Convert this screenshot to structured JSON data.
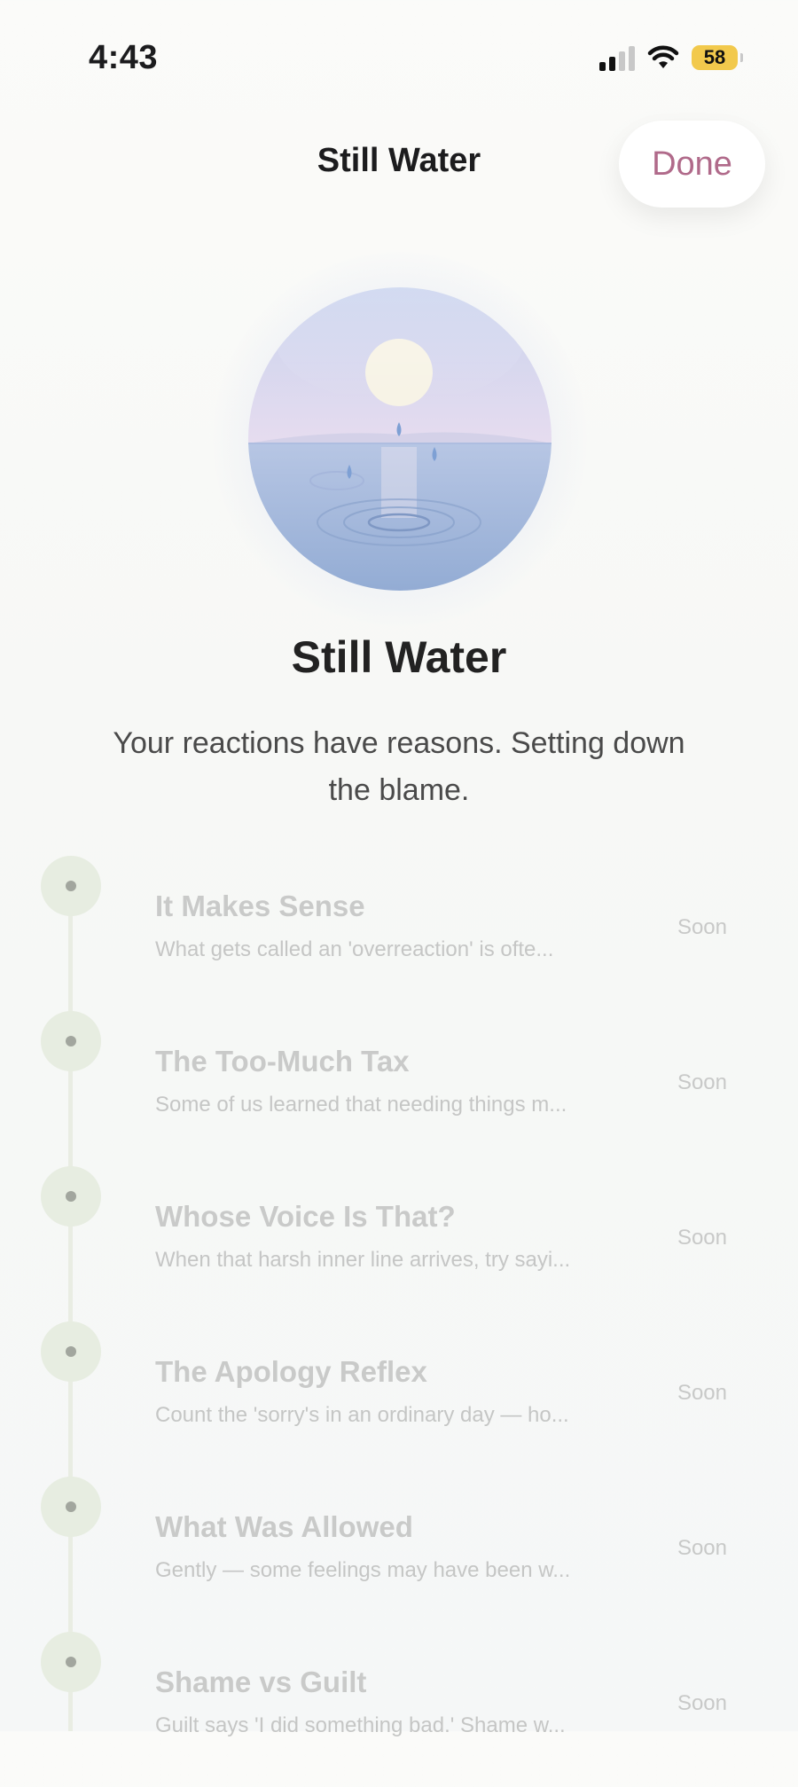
{
  "status_bar": {
    "time": "4:43",
    "battery": "58"
  },
  "nav": {
    "title": "Still Water",
    "done_label": "Done"
  },
  "colors": {
    "accent": "#b06a8a",
    "battery": "#f2c94c"
  },
  "hero": {
    "title": "Still Water",
    "subtitle": "Your reactions have reasons. Setting down the blame."
  },
  "lessons": [
    {
      "title": "It Makes Sense",
      "description": "What gets called an 'overreaction' is ofte...",
      "status": "Soon"
    },
    {
      "title": "The Too-Much Tax",
      "description": "Some of us learned that needing things m...",
      "status": "Soon"
    },
    {
      "title": "Whose Voice Is That?",
      "description": "When that harsh inner line arrives, try sayi...",
      "status": "Soon"
    },
    {
      "title": "The Apology Reflex",
      "description": "Count the 'sorry's in an ordinary day — ho...",
      "status": "Soon"
    },
    {
      "title": "What Was Allowed",
      "description": "Gently — some feelings may have been w...",
      "status": "Soon"
    },
    {
      "title": "Shame vs Guilt",
      "description": "Guilt says 'I did something bad.' Shame w...",
      "status": "Soon"
    }
  ]
}
